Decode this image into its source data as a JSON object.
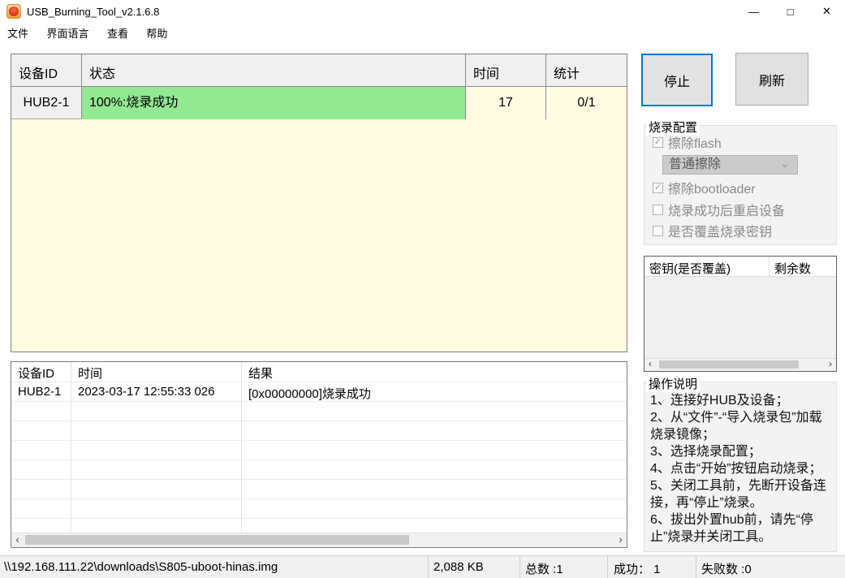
{
  "window": {
    "title": "USB_Burning_Tool_v2.1.6.8",
    "controls": {
      "minimize": "—",
      "maximize": "□",
      "close": "✕"
    }
  },
  "menu": {
    "items": [
      "文件",
      "界面语言",
      "查看",
      "帮助"
    ]
  },
  "device_table": {
    "headers": [
      "设备ID",
      "状态",
      "时间",
      "统计"
    ],
    "row": {
      "device_id": "HUB2-1",
      "status": "100%:烧录成功",
      "time": "17",
      "stat": "0/1"
    }
  },
  "actions": {
    "stop": "停止",
    "refresh": "刷新"
  },
  "burn_config": {
    "title": "烧录配置",
    "items": [
      {
        "label": "擦除flash",
        "check": "✓"
      },
      {
        "label": "擦除bootloader",
        "check": "✓"
      },
      {
        "label": "烧录成功后重启设备",
        "check": ""
      },
      {
        "label": "是否覆盖烧录密钥",
        "check": ""
      }
    ],
    "erase_mode": {
      "value": "普通擦除"
    }
  },
  "key_table": {
    "headers": [
      "密钥(是否覆盖)",
      "剩余数"
    ]
  },
  "instructions": {
    "title": "操作说明",
    "lines": [
      "1、连接好HUB及设备；",
      "2、从“文件”-“导入烧录包”加载烧录镜像；",
      "3、选择烧录配置；",
      "4、点击“开始”按钮启动烧录；",
      "5、关闭工具前，先断开设备连接，再“停止”烧录。",
      "6、拔出外置hub前，请先“停止”烧录并关闭工具。"
    ]
  },
  "log_table": {
    "headers": [
      "设备ID",
      "时间",
      "结果"
    ],
    "row": {
      "device_id": "HUB2-1",
      "time": "2023-03-17 12:55:33 026",
      "result": "[0x00000000]烧录成功"
    }
  },
  "status_bar": {
    "image_path": "\\\\192.168.111.22\\downloads\\S805-uboot-hinas.img",
    "image_size": "2,088 KB",
    "total": "总数 :1",
    "success": "成功： 1",
    "failed": "失败数 :0"
  },
  "icons": {
    "scroll_left": "‹",
    "scroll_right": "›",
    "chevron_down": "⌄"
  },
  "colors": {
    "accent_blue": "#0078d7",
    "success_green": "#92e992",
    "row_cream": "#fffce1"
  }
}
